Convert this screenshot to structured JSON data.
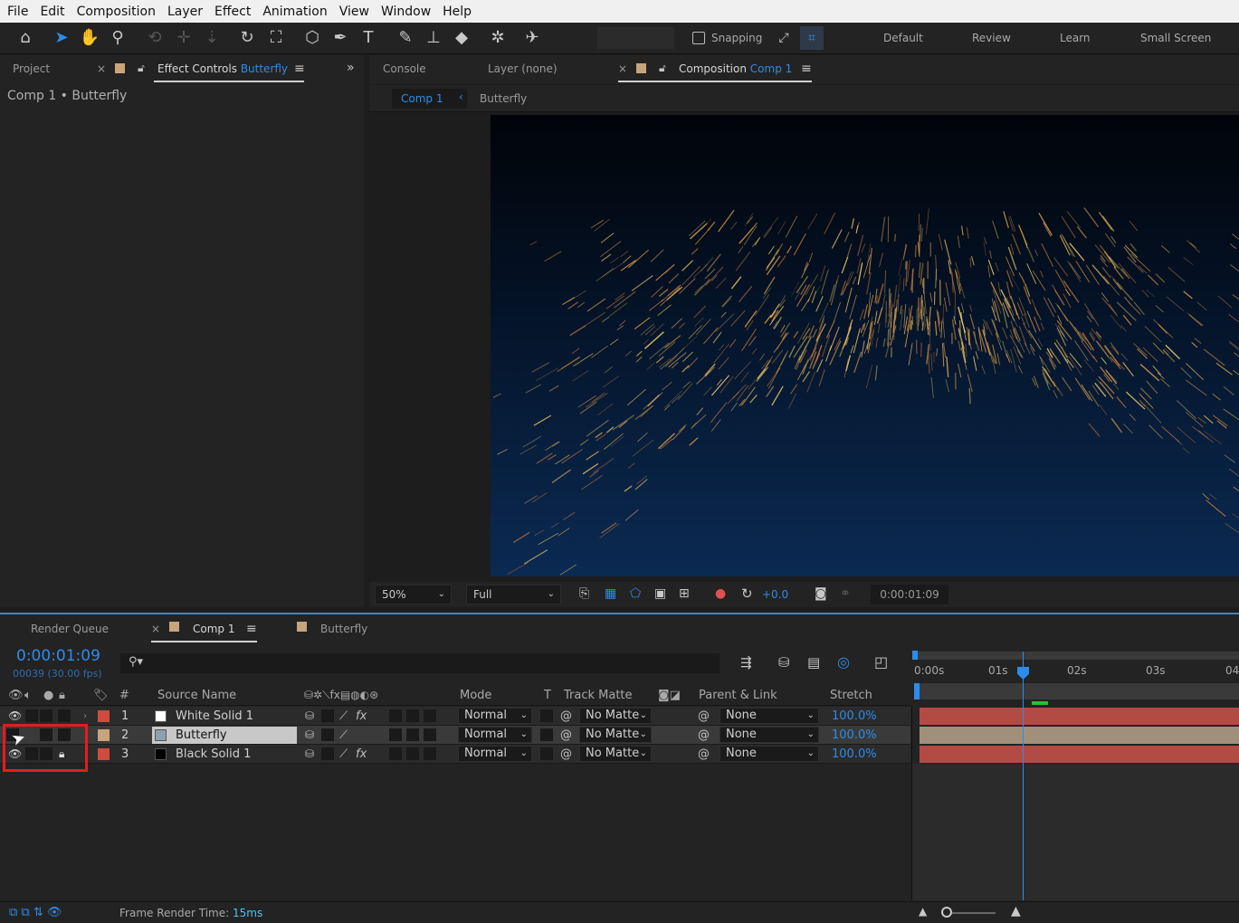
{
  "menu": [
    "File",
    "Edit",
    "Composition",
    "Layer",
    "Effect",
    "Animation",
    "View",
    "Window",
    "Help"
  ],
  "toolbar": {
    "snapping_label": "Snapping",
    "workspaces": [
      "Default",
      "Review",
      "Learn",
      "Small Screen"
    ]
  },
  "left_panel": {
    "tab_project": "Project",
    "tab_effect_controls": "Effect Controls",
    "tab_effect_controls_target": "Butterfly",
    "breadcrumb": "Comp 1 • Butterfly"
  },
  "viewer_panel": {
    "tab_console": "Console",
    "tab_layer": "Layer (none)",
    "tab_composition": "Composition",
    "tab_composition_target": "Comp 1",
    "subtab_comp": "Comp 1",
    "subtab_butterfly": "Butterfly",
    "zoom": "50%",
    "resolution": "Full",
    "exposure": "+0.0",
    "timecode": "0:00:01:09"
  },
  "timeline": {
    "tab_render_queue": "Render Queue",
    "tab_comp": "Comp 1",
    "tab_butterfly": "Butterfly",
    "current_time": "0:00:01:09",
    "frame_info": "00039 (30.00 fps)",
    "columns": {
      "number": "#",
      "source_name": "Source Name",
      "mode": "Mode",
      "t": "T",
      "track_matte": "Track Matte",
      "parent_link": "Parent & Link",
      "stretch": "Stretch"
    },
    "ruler": [
      "0:00s",
      "01s",
      "02s",
      "03s",
      "04"
    ],
    "layers": [
      {
        "num": "1",
        "name": "White Solid 1",
        "mode": "Normal",
        "matte": "No Matte",
        "parent": "None",
        "stretch": "100.0%",
        "label_color": "#d04b3e",
        "thumb": "#ffffff",
        "bar_color": "#b34b45"
      },
      {
        "num": "2",
        "name": "Butterfly",
        "mode": "Normal",
        "matte": "No Matte",
        "parent": "None",
        "stretch": "100.0%",
        "label_color": "#c8a47c",
        "thumb": "#8fa0b0",
        "bar_color": "#a0907a"
      },
      {
        "num": "3",
        "name": "Black Solid 1",
        "mode": "Normal",
        "matte": "No Matte",
        "parent": "None",
        "stretch": "100.0%",
        "label_color": "#d04b3e",
        "thumb": "#000000",
        "bar_color": "#b34b45"
      }
    ],
    "footer_render_label": "Frame Render Time:",
    "footer_render_value": "15ms"
  },
  "colors": {
    "accent": "#2d8ceb",
    "highlight_box": "#e01e1e"
  }
}
